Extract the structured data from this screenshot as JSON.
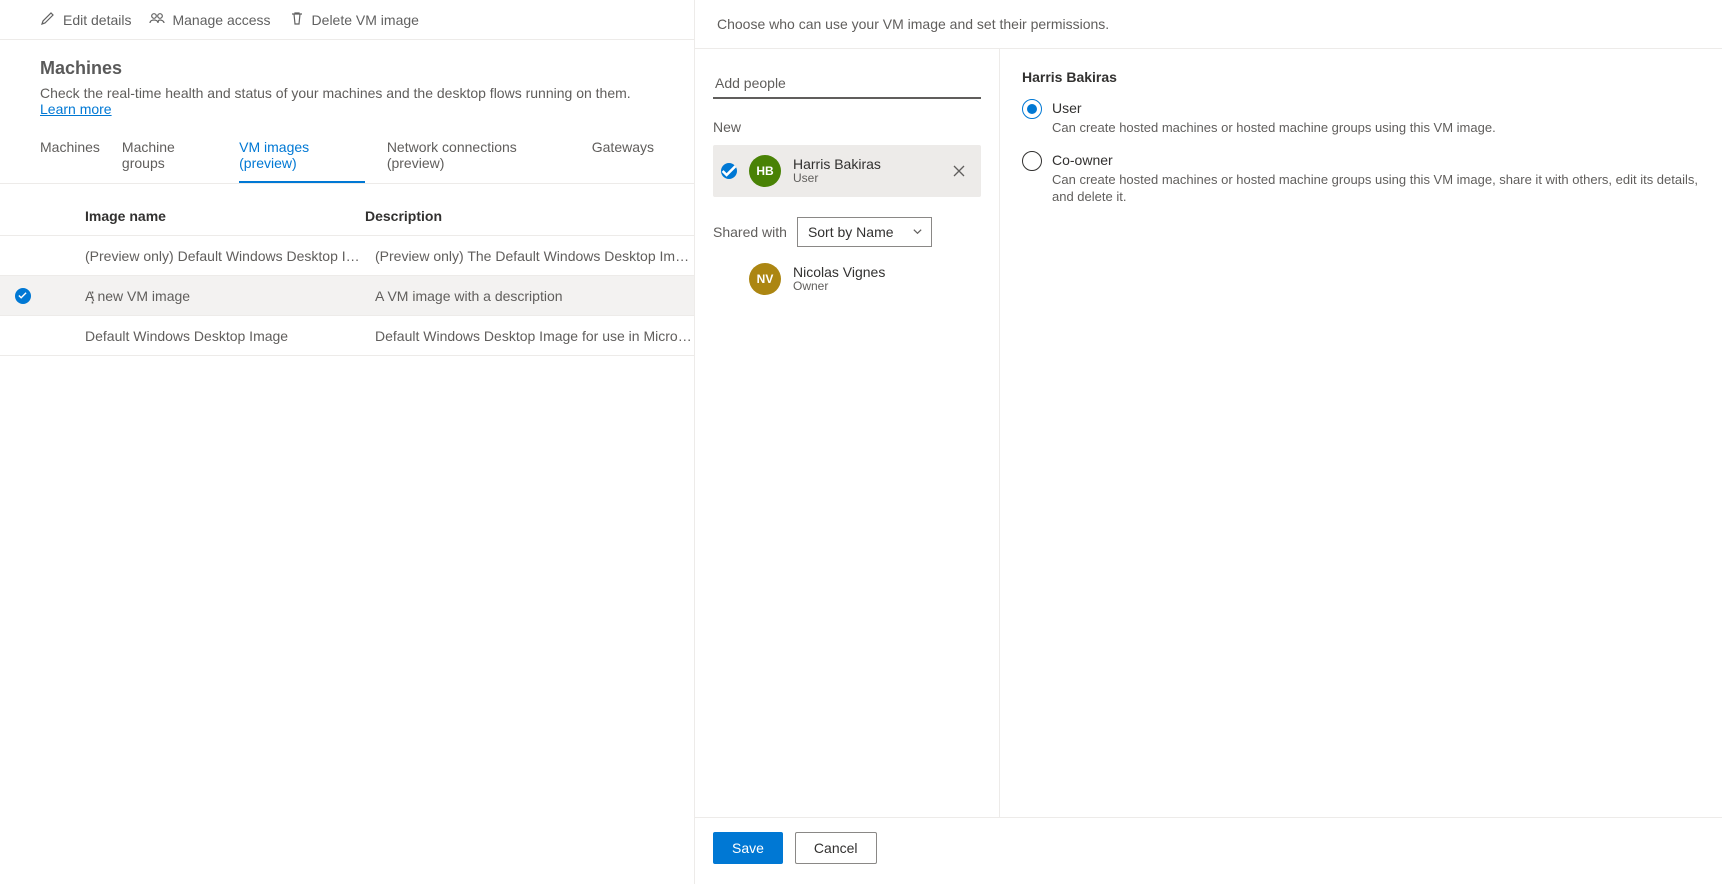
{
  "toolbar": {
    "edit_label": "Edit details",
    "manage_access_label": "Manage access",
    "delete_label": "Delete VM image"
  },
  "page": {
    "title": "Machines",
    "subtitle_prefix": "Check the real-time health and status of your machines and the desktop flows running on them. ",
    "learn_more": "Learn more"
  },
  "tabs": [
    {
      "label": "Machines",
      "active": false
    },
    {
      "label": "Machine groups",
      "active": false
    },
    {
      "label": "VM images (preview)",
      "active": true
    },
    {
      "label": "Network connections (preview)",
      "active": false
    },
    {
      "label": "Gateways",
      "active": false
    }
  ],
  "table": {
    "columns": {
      "name": "Image name",
      "description": "Description"
    },
    "rows": [
      {
        "selected": false,
        "name": "(Preview only) Default Windows Desktop Ima…",
        "description": "(Preview only) The Default Windows Desktop Image for use i…"
      },
      {
        "selected": true,
        "name": "A new VM image",
        "description": "A VM image with a description"
      },
      {
        "selected": false,
        "name": "Default Windows Desktop Image",
        "description": "Default Windows Desktop Image for use in Microsoft Deskto…"
      }
    ]
  },
  "panel": {
    "header_text": "Choose who can use your VM image and set their permissions.",
    "add_people_placeholder": "Add people",
    "new_label": "New",
    "new_people": [
      {
        "initials": "HB",
        "name": "Harris Bakiras",
        "role": "User",
        "avatar_color": "green"
      }
    ],
    "shared_with_label": "Shared with",
    "sort_label": "Sort by Name",
    "shared_people": [
      {
        "initials": "NV",
        "name": "Nicolas Vignes",
        "role": "Owner",
        "avatar_color": "olive"
      }
    ],
    "right": {
      "title": "Harris Bakiras",
      "options": [
        {
          "label": "User",
          "desc": "Can create hosted machines or hosted machine groups using this VM image.",
          "checked": true
        },
        {
          "label": "Co-owner",
          "desc": "Can create hosted machines or hosted machine groups using this VM image, share it with others, edit its details, and delete it.",
          "checked": false
        }
      ]
    },
    "footer": {
      "save": "Save",
      "cancel": "Cancel"
    }
  }
}
